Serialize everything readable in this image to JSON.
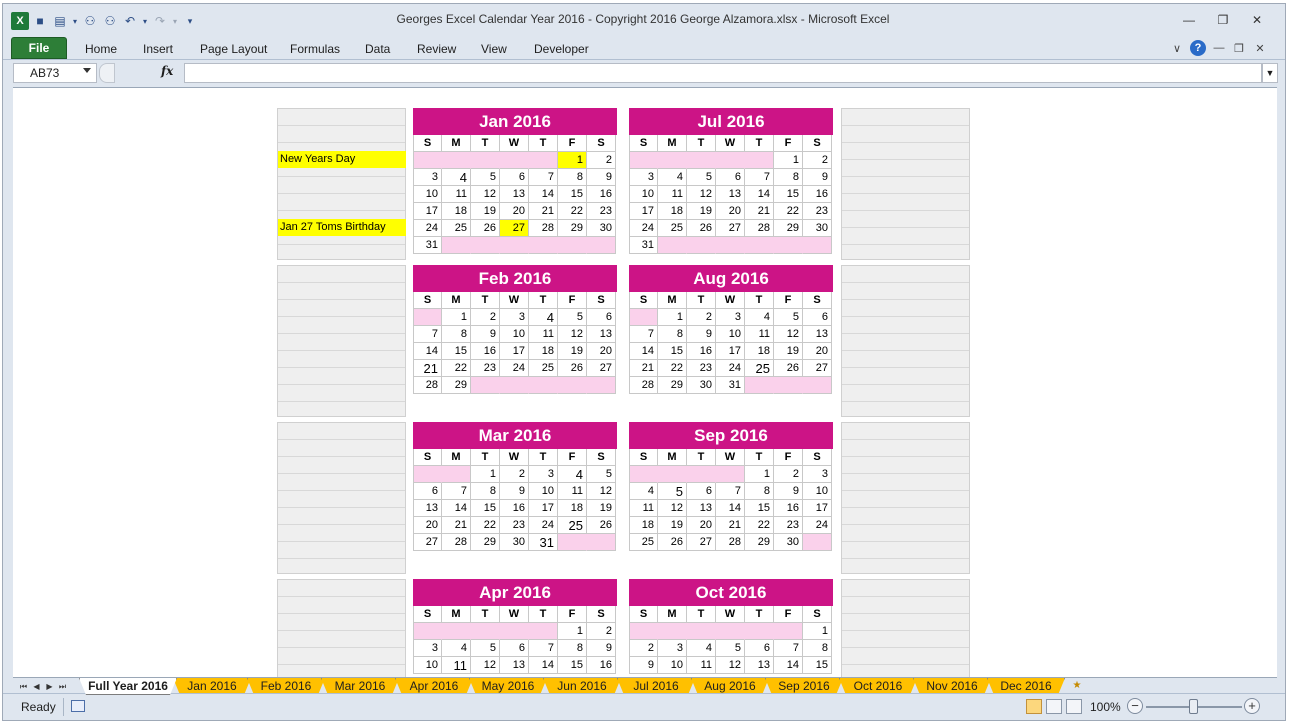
{
  "window": {
    "title": "Georges Excel Calendar Year 2016  -  Copyright 2016 George Alzamora.xlsx  -  Microsoft Excel",
    "minimize_glyph": "—",
    "restore_glyph": "❐",
    "close_glyph": "✕"
  },
  "qat": {
    "excel_glyph": "X",
    "save_glyph": "■",
    "print_glyph": "▤",
    "find_glyph": "⚇",
    "replace_glyph": "⚇",
    "undo_glyph": "↶",
    "redo_glyph": "↷",
    "customize_glyph": "▾"
  },
  "ribbon": {
    "file_label": "File",
    "tabs": [
      "Home",
      "Insert",
      "Page Layout",
      "Formulas",
      "Data",
      "Review",
      "View",
      "Developer"
    ],
    "help_glyph": "?",
    "collapse_glyph": "∨"
  },
  "formula_bar": {
    "name_box": "AB73",
    "fx_label": "fx",
    "formula": ""
  },
  "calendars": [
    {
      "title": "Jan 2016",
      "dow": [
        "S",
        "M",
        "T",
        "W",
        "T",
        "F",
        "S"
      ],
      "weeks": [
        [
          "",
          "",
          "",
          "",
          "",
          "1",
          "2"
        ],
        [
          "3",
          "4",
          "5",
          "6",
          "7",
          "8",
          "9"
        ],
        [
          "10",
          "11",
          "12",
          "13",
          "14",
          "15",
          "16"
        ],
        [
          "17",
          "18",
          "19",
          "20",
          "21",
          "22",
          "23"
        ],
        [
          "24",
          "25",
          "26",
          "27",
          "28",
          "29",
          "30"
        ],
        [
          "31",
          "",
          "",
          "",
          "",
          "",
          ""
        ]
      ],
      "highlighted_days": [
        "1",
        "27"
      ],
      "large_days": [
        "4"
      ]
    },
    {
      "title": "Feb 2016",
      "dow": [
        "S",
        "M",
        "T",
        "W",
        "T",
        "F",
        "S"
      ],
      "weeks": [
        [
          "",
          "1",
          "2",
          "3",
          "4",
          "5",
          "6"
        ],
        [
          "7",
          "8",
          "9",
          "10",
          "11",
          "12",
          "13"
        ],
        [
          "14",
          "15",
          "16",
          "17",
          "18",
          "19",
          "20"
        ],
        [
          "21",
          "22",
          "23",
          "24",
          "25",
          "26",
          "27"
        ],
        [
          "28",
          "29",
          "",
          "",
          "",
          "",
          ""
        ]
      ],
      "highlighted_days": [],
      "large_days": [
        "4",
        "21"
      ]
    },
    {
      "title": "Mar 2016",
      "dow": [
        "S",
        "M",
        "T",
        "W",
        "T",
        "F",
        "S"
      ],
      "weeks": [
        [
          "",
          "",
          "1",
          "2",
          "3",
          "4",
          "5"
        ],
        [
          "6",
          "7",
          "8",
          "9",
          "10",
          "11",
          "12"
        ],
        [
          "13",
          "14",
          "15",
          "16",
          "17",
          "18",
          "19"
        ],
        [
          "20",
          "21",
          "22",
          "23",
          "24",
          "25",
          "26"
        ],
        [
          "27",
          "28",
          "29",
          "30",
          "31",
          "",
          ""
        ]
      ],
      "highlighted_days": [],
      "large_days": [
        "4",
        "25",
        "31"
      ]
    },
    {
      "title": "Apr 2016",
      "dow": [
        "S",
        "M",
        "T",
        "W",
        "T",
        "F",
        "S"
      ],
      "weeks": [
        [
          "",
          "",
          "",
          "",
          "",
          "1",
          "2"
        ],
        [
          "3",
          "4",
          "5",
          "6",
          "7",
          "8",
          "9"
        ],
        [
          "10",
          "11",
          "12",
          "13",
          "14",
          "15",
          "16"
        ]
      ],
      "highlighted_days": [],
      "large_days": [
        "11"
      ]
    },
    {
      "title": "Jul 2016",
      "dow": [
        "S",
        "M",
        "T",
        "W",
        "T",
        "F",
        "S"
      ],
      "weeks": [
        [
          "",
          "",
          "",
          "",
          "",
          "1",
          "2"
        ],
        [
          "3",
          "4",
          "5",
          "6",
          "7",
          "8",
          "9"
        ],
        [
          "10",
          "11",
          "12",
          "13",
          "14",
          "15",
          "16"
        ],
        [
          "17",
          "18",
          "19",
          "20",
          "21",
          "22",
          "23"
        ],
        [
          "24",
          "25",
          "26",
          "27",
          "28",
          "29",
          "30"
        ],
        [
          "31",
          "",
          "",
          "",
          "",
          "",
          ""
        ]
      ],
      "highlighted_days": [],
      "large_days": []
    },
    {
      "title": "Aug 2016",
      "dow": [
        "S",
        "M",
        "T",
        "W",
        "T",
        "F",
        "S"
      ],
      "weeks": [
        [
          "",
          "1",
          "2",
          "3",
          "4",
          "5",
          "6"
        ],
        [
          "7",
          "8",
          "9",
          "10",
          "11",
          "12",
          "13"
        ],
        [
          "14",
          "15",
          "16",
          "17",
          "18",
          "19",
          "20"
        ],
        [
          "21",
          "22",
          "23",
          "24",
          "25",
          "26",
          "27"
        ],
        [
          "28",
          "29",
          "30",
          "31",
          "",
          "",
          ""
        ]
      ],
      "highlighted_days": [],
      "large_days": [
        "25"
      ]
    },
    {
      "title": "Sep 2016",
      "dow": [
        "S",
        "M",
        "T",
        "W",
        "T",
        "F",
        "S"
      ],
      "weeks": [
        [
          "",
          "",
          "",
          "",
          "1",
          "2",
          "3"
        ],
        [
          "4",
          "5",
          "6",
          "7",
          "8",
          "9",
          "10"
        ],
        [
          "11",
          "12",
          "13",
          "14",
          "15",
          "16",
          "17"
        ],
        [
          "18",
          "19",
          "20",
          "21",
          "22",
          "23",
          "24"
        ],
        [
          "25",
          "26",
          "27",
          "28",
          "29",
          "30",
          ""
        ]
      ],
      "highlighted_days": [],
      "large_days": [
        "5"
      ]
    },
    {
      "title": "Oct 2016",
      "dow": [
        "S",
        "M",
        "T",
        "W",
        "T",
        "F",
        "S"
      ],
      "weeks": [
        [
          "",
          "",
          "",
          "",
          "",
          "",
          "1"
        ],
        [
          "2",
          "3",
          "4",
          "5",
          "6",
          "7",
          "8"
        ],
        [
          "9",
          "10",
          "11",
          "12",
          "13",
          "14",
          "15"
        ]
      ],
      "highlighted_days": [],
      "large_days": []
    }
  ],
  "side_notes": [
    {
      "block": 0,
      "row": 2,
      "text": "New Years Day"
    },
    {
      "block": 0,
      "row": 6,
      "text": "Jan 27 Toms Birthday"
    }
  ],
  "sheet_tabs": {
    "nav": [
      "⏮",
      "◀",
      "▶",
      "⏭"
    ],
    "tabs": [
      "Full Year 2016",
      "Jan 2016",
      "Feb 2016",
      "Mar 2016",
      "Apr 2016",
      "May 2016",
      "Jun 2016",
      "Jul 2016",
      "Aug 2016",
      "Sep 2016",
      "Oct 2016",
      "Nov 2016",
      "Dec 2016"
    ],
    "active": "Full Year 2016",
    "new_sheet_glyph": "★"
  },
  "status": {
    "ready": "Ready",
    "zoom": "100%",
    "zoom_minus": "−",
    "zoom_plus": "+"
  },
  "colors": {
    "title_bar": "#cc1486",
    "blank_day": "#fad1eb",
    "highlight": "#ffff00",
    "sheet_tab": "#ffc000",
    "file_tab": "#2d7e37"
  }
}
